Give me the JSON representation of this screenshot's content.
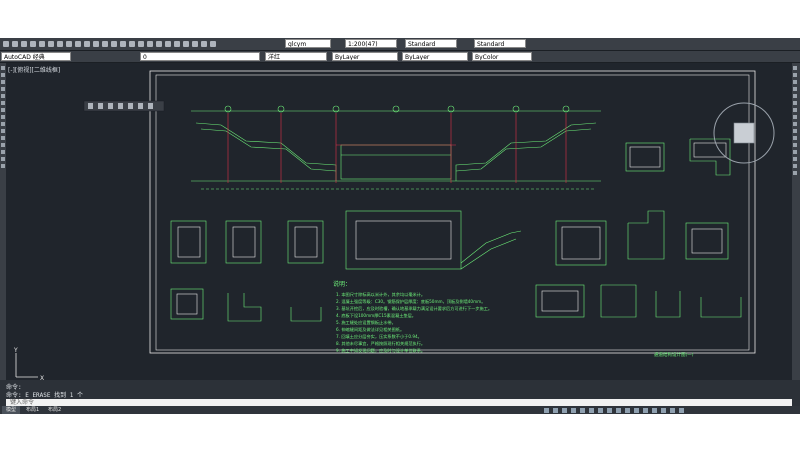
{
  "toolbar": {
    "annotation_scale_combo": "glcym",
    "scale_combo": "1:200(47)",
    "text_style_combo": "Standard",
    "dim_style_combo": "Standard",
    "workspace_combo": "AutoCAD 经典",
    "layer_combo": "0",
    "color_combo": "洋红",
    "linetype_combo": "ByLayer",
    "lineweight_combo": "ByLayer",
    "plotstyle_combo": "ByColor"
  },
  "document": {
    "title": "[-][俯视][二维线框]"
  },
  "drawing": {
    "notes_title": "说明：",
    "notes": [
      "1. 本图尺寸除标高以米计外，其余均以毫米计。",
      "2. 混凝土强度等级：C30。钢筋保护层厚度：底板50mm，顶板及侧墙40mm。",
      "3. 基坑开挖后，应及时验槽，确认地基承载力满足设计要求后方可进行下一步施工。",
      "4. 底板下设100mm厚C15素混凝土垫层。",
      "5. 施工缝处应设置钢板止水带。",
      "6. 伸缩缝间距及做法详见相关图纸。",
      "7. 回填土应分层夯实，压实系数不小于0.94。",
      "8. 其他未尽事宜，严格按照现行相关规范执行。",
      "9. 施工中如发现问题，应及时与设计单位联系。"
    ],
    "title_block": "通道结构设计图(一)"
  },
  "command": {
    "history_1": "命令:",
    "history_2": "命令: E ERASE 找到 1 个",
    "input_placeholder": "键入命令"
  },
  "layout_tabs": [
    "模型",
    "布局1",
    "布局2"
  ],
  "colors": {
    "drawing_green": "#6ef07a",
    "drawing_red": "#e0304a",
    "drawing_white": "#e8e8e8",
    "canvas_bg": "#20252c"
  }
}
